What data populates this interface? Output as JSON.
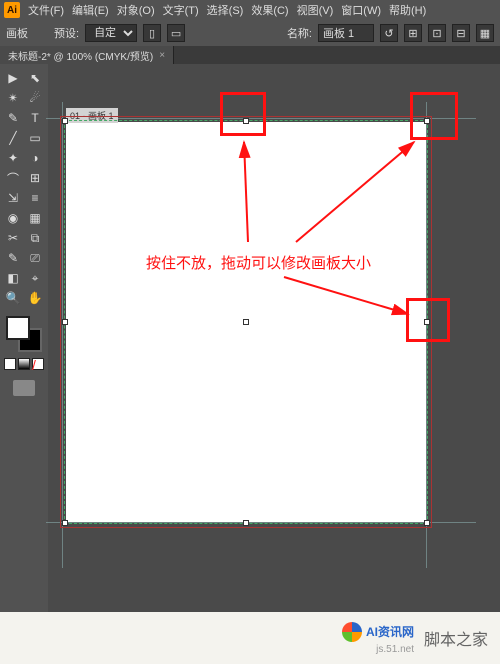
{
  "app_logo_text": "Ai",
  "menu": [
    "文件(F)",
    "编辑(E)",
    "对象(O)",
    "文字(T)",
    "选择(S)",
    "效果(C)",
    "视图(V)",
    "窗口(W)",
    "帮助(H)"
  ],
  "options": {
    "label_board": "画板",
    "label_preset": "预设:",
    "preset_value": "自定",
    "label_name": "名称:",
    "name_value": "画板 1",
    "icons": [
      "↺",
      "⊞",
      "⊡",
      "⊟",
      "▦"
    ]
  },
  "tab": {
    "title": "未标题-2* @ 100% (CMYK/预览)",
    "close": "×"
  },
  "artboard": {
    "label": "01 - 画板 1"
  },
  "annotation": {
    "text": "按住不放，拖动可以修改画板大小"
  },
  "tools": [
    "▶",
    "⬉",
    "✴",
    "☄",
    "✎",
    "T",
    "╱",
    "▭",
    "✦",
    "◑",
    "⌒",
    "⊞",
    "⇲",
    "≡",
    "◉",
    "▦",
    "✂",
    "⧉",
    "✎",
    "⎚",
    "◧",
    "⌖",
    "🔍",
    "✋"
  ],
  "swatch_minis": [
    "#ffffff",
    "#000000",
    "#ff2222"
  ],
  "footer": {
    "site_text": "js.51.net",
    "brand_text": "AI资讯网",
    "jb_text": "脚本之家"
  }
}
